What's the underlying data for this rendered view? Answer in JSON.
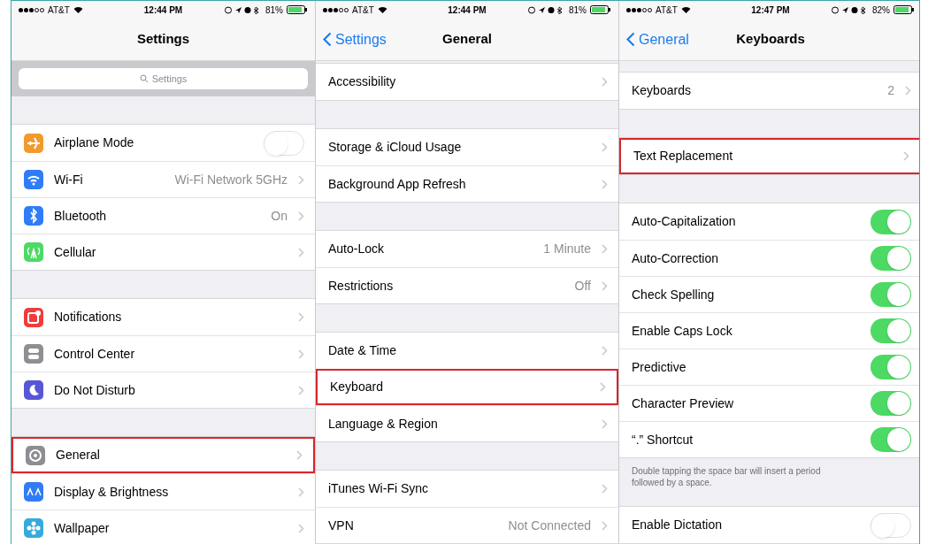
{
  "screens": [
    {
      "status_bar": {
        "carrier": "AT&T",
        "time": "12:44 PM",
        "battery": "81%"
      },
      "nav": {
        "title": "Settings"
      },
      "groups": [
        {
          "kind": "search",
          "placeholder": "Settings"
        },
        {
          "kind": "rows",
          "rows": [
            {
              "label": "Airplane Mode",
              "color": "#f29a2e",
              "kind": "toggle",
              "on": false,
              "highlighted": false
            },
            {
              "label": "Wi-Fi",
              "value": "Wi-Fi Network 5GHz",
              "color": "#2f7cf6",
              "kind": "chevron",
              "highlighted": false
            },
            {
              "label": "Bluetooth",
              "value": "On",
              "color": "#2f7cf6",
              "kind": "chevron",
              "highlighted": false
            },
            {
              "label": "Cellular",
              "color": "#4cd964",
              "kind": "chevron",
              "highlighted": false
            }
          ]
        },
        {
          "kind": "rows",
          "rows": [
            {
              "label": "Notifications",
              "color": "#f03c3c",
              "kind": "chevron",
              "highlighted": false
            },
            {
              "label": "Control Center",
              "color": "#8e8e93",
              "kind": "chevron",
              "highlighted": false
            },
            {
              "label": "Do Not Disturb",
              "color": "#5856d6",
              "kind": "chevron",
              "highlighted": false
            }
          ]
        },
        {
          "kind": "rows",
          "rows": [
            {
              "label": "General",
              "color": "#8e8e92",
              "kind": "chevron",
              "highlighted": true
            },
            {
              "label": "Display & Brightness",
              "color": "#2f7cf5",
              "kind": "chevron",
              "highlighted": false
            },
            {
              "label": "Wallpaper",
              "color": "#36aadc",
              "kind": "chevron",
              "highlighted": false
            }
          ]
        }
      ]
    },
    {
      "status_bar": {
        "carrier": "AT&T",
        "time": "12:44 PM",
        "battery": "81%"
      },
      "nav": {
        "back": "Settings",
        "title": "General"
      },
      "groups": [
        {
          "kind": "rows",
          "rows": [
            {
              "label": "Accessibility",
              "kind": "chevron",
              "highlighted": false
            }
          ]
        },
        {
          "kind": "rows",
          "rows": [
            {
              "label": "Storage & iCloud Usage",
              "kind": "chevron",
              "highlighted": false
            },
            {
              "label": "Background App Refresh",
              "kind": "chevron",
              "highlighted": false
            }
          ]
        },
        {
          "kind": "rows",
          "rows": [
            {
              "label": "Auto-Lock",
              "value": "1 Minute",
              "kind": "chevron",
              "highlighted": false
            },
            {
              "label": "Restrictions",
              "value": "Off",
              "kind": "chevron",
              "highlighted": false
            }
          ]
        },
        {
          "kind": "rows",
          "rows": [
            {
              "label": "Date & Time",
              "kind": "chevron",
              "highlighted": false
            },
            {
              "label": "Keyboard",
              "kind": "chevron",
              "highlighted": true
            },
            {
              "label": "Language & Region",
              "kind": "chevron",
              "highlighted": false
            }
          ]
        },
        {
          "kind": "rows",
          "rows": [
            {
              "label": "iTunes Wi-Fi Sync",
              "kind": "chevron",
              "highlighted": false
            },
            {
              "label": "VPN",
              "value": "Not Connected",
              "kind": "chevron",
              "highlighted": false
            }
          ]
        }
      ]
    },
    {
      "status_bar": {
        "carrier": "AT&T",
        "time": "12:47 PM",
        "battery": "82%"
      },
      "nav": {
        "back": "General",
        "title": "Keyboards"
      },
      "groups": [
        {
          "kind": "rows",
          "rows": [
            {
              "label": "Keyboards",
              "value": "2",
              "kind": "chevron",
              "highlighted": false
            }
          ]
        },
        {
          "kind": "rows",
          "rows": [
            {
              "label": "Text Replacement",
              "kind": "chevron",
              "highlighted": true
            }
          ]
        },
        {
          "kind": "rows",
          "rows": [
            {
              "label": "Auto-Capitalization",
              "kind": "toggle",
              "on": true,
              "highlighted": false
            },
            {
              "label": "Auto-Correction",
              "kind": "toggle",
              "on": true,
              "highlighted": false
            },
            {
              "label": "Check Spelling",
              "kind": "toggle",
              "on": true,
              "highlighted": false
            },
            {
              "label": "Enable Caps Lock",
              "kind": "toggle",
              "on": true,
              "highlighted": false
            },
            {
              "label": "Predictive",
              "kind": "toggle",
              "on": true,
              "highlighted": false
            },
            {
              "label": "Character Preview",
              "kind": "toggle",
              "on": true,
              "highlighted": false
            },
            {
              "label": "“.” Shortcut",
              "kind": "toggle",
              "on": true,
              "highlighted": false
            }
          ],
          "footer": "Double tapping the space bar will insert a period followed by a space."
        },
        {
          "kind": "rows",
          "rows": [
            {
              "label": "Enable Dictation",
              "kind": "toggle",
              "on": false,
              "highlighted": false
            }
          ]
        }
      ]
    }
  ]
}
